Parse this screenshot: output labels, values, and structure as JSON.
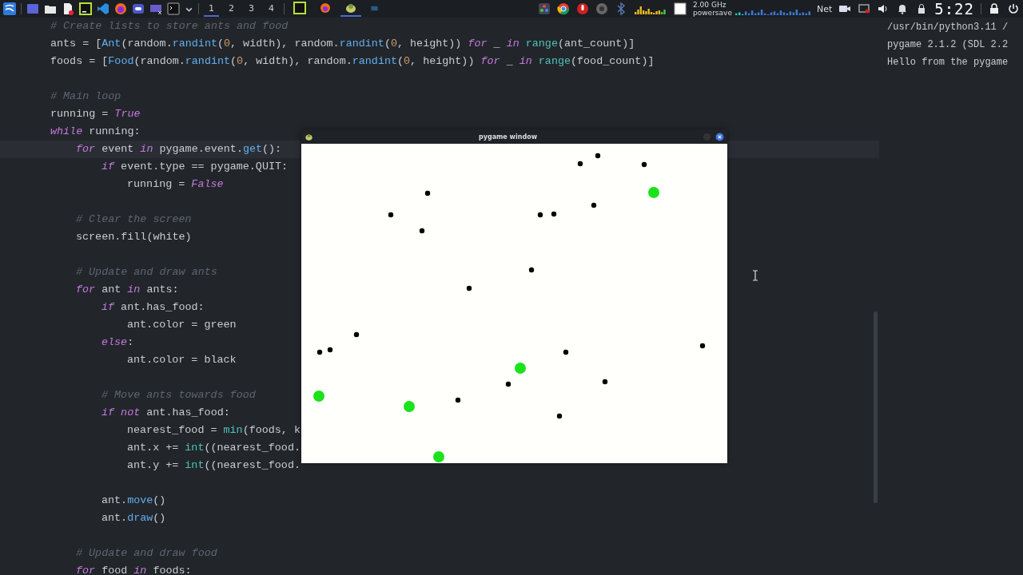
{
  "taskbar": {
    "launchers": [
      {
        "kind": "launcher"
      },
      {
        "kind": "desktop"
      },
      {
        "kind": "files"
      },
      {
        "kind": "document"
      },
      {
        "kind": "pycharm"
      },
      {
        "kind": "vscode"
      },
      {
        "kind": "firefox"
      },
      {
        "kind": "discord"
      },
      {
        "kind": "screenshot"
      },
      {
        "kind": "terminal"
      }
    ],
    "desktops": [
      {
        "label": "1",
        "selected": true
      },
      {
        "label": "2",
        "selected": false
      },
      {
        "label": "3",
        "selected": false
      },
      {
        "label": "4",
        "selected": false
      }
    ],
    "tasks": [
      {
        "kind": "pycharm",
        "selected": false
      },
      {
        "kind": "firefox",
        "selected": false
      },
      {
        "kind": "pygame",
        "selected": true
      },
      {
        "kind": "window",
        "selected": false
      }
    ],
    "cpu_frequency": "2.00 GHz",
    "cpu_governor": "powersave",
    "net_label": "Net",
    "clock": "5:22"
  },
  "editor": {
    "lines": [
      {
        "tokens": [
          {
            "t": "# Create lists to store ants and food",
            "kind": "comment"
          }
        ]
      },
      {
        "tokens": [
          {
            "t": "ants = [",
            "kind": "plain"
          },
          {
            "t": "Ant",
            "kind": "func"
          },
          {
            "t": "(random.",
            "kind": "plain"
          },
          {
            "t": "randint",
            "kind": "func"
          },
          {
            "t": "(",
            "kind": "plain"
          },
          {
            "t": "0",
            "kind": "number"
          },
          {
            "t": ", width), random.",
            "kind": "plain"
          },
          {
            "t": "randint",
            "kind": "func"
          },
          {
            "t": "(",
            "kind": "plain"
          },
          {
            "t": "0",
            "kind": "number"
          },
          {
            "t": ", height)) ",
            "kind": "plain"
          },
          {
            "t": "for",
            "kind": "keyword"
          },
          {
            "t": " _ ",
            "kind": "plain"
          },
          {
            "t": "in",
            "kind": "keyword"
          },
          {
            "t": " range",
            "kind": "builtin"
          },
          {
            "t": "(ant_count)]",
            "kind": "plain"
          }
        ]
      },
      {
        "tokens": [
          {
            "t": "foods = [",
            "kind": "plain"
          },
          {
            "t": "Food",
            "kind": "func"
          },
          {
            "t": "(random.",
            "kind": "plain"
          },
          {
            "t": "randint",
            "kind": "func"
          },
          {
            "t": "(",
            "kind": "plain"
          },
          {
            "t": "0",
            "kind": "number"
          },
          {
            "t": ", width), random.",
            "kind": "plain"
          },
          {
            "t": "randint",
            "kind": "func"
          },
          {
            "t": "(",
            "kind": "plain"
          },
          {
            "t": "0",
            "kind": "number"
          },
          {
            "t": ", height)) ",
            "kind": "plain"
          },
          {
            "t": "for",
            "kind": "keyword"
          },
          {
            "t": " _ ",
            "kind": "plain"
          },
          {
            "t": "in",
            "kind": "keyword"
          },
          {
            "t": " range",
            "kind": "builtin"
          },
          {
            "t": "(food_count)]",
            "kind": "plain"
          }
        ]
      },
      {
        "gap_before": true,
        "tokens": [
          {
            "t": "# Main loop",
            "kind": "comment"
          }
        ]
      },
      {
        "tokens": [
          {
            "t": "running = ",
            "kind": "plain"
          },
          {
            "t": "True",
            "kind": "keyword"
          }
        ]
      },
      {
        "tokens": [
          {
            "t": "while",
            "kind": "keyword"
          },
          {
            "t": " running:",
            "kind": "plain"
          }
        ],
        "children": [
          {
            "current": true,
            "tokens": [
              {
                "t": "for",
                "kind": "keyword"
              },
              {
                "t": " event ",
                "kind": "plain"
              },
              {
                "t": "in",
                "kind": "keyword"
              },
              {
                "t": " pygame.event.",
                "kind": "plain"
              },
              {
                "t": "get",
                "kind": "func"
              },
              {
                "t": "():",
                "kind": "plain"
              }
            ],
            "children": [
              {
                "tokens": [
                  {
                    "t": "if",
                    "kind": "keyword"
                  },
                  {
                    "t": " event.type == pygame.QUIT:",
                    "kind": "plain"
                  }
                ],
                "children": [
                  {
                    "tokens": [
                      {
                        "t": "running = ",
                        "kind": "plain"
                      },
                      {
                        "t": "False",
                        "kind": "keyword"
                      }
                    ]
                  }
                ]
              }
            ]
          },
          {
            "gap_before": true,
            "tokens": [
              {
                "t": "# Clear the screen",
                "kind": "comment"
              }
            ]
          },
          {
            "tokens": [
              {
                "t": "screen.fill(white)",
                "kind": "plain"
              }
            ]
          },
          {
            "gap_before": true,
            "tokens": [
              {
                "t": "# Update and draw ants",
                "kind": "comment"
              }
            ]
          },
          {
            "tokens": [
              {
                "t": "for",
                "kind": "keyword"
              },
              {
                "t": " ant ",
                "kind": "plain"
              },
              {
                "t": "in",
                "kind": "keyword"
              },
              {
                "t": " ants:",
                "kind": "plain"
              }
            ],
            "children": [
              {
                "tokens": [
                  {
                    "t": "if",
                    "kind": "keyword"
                  },
                  {
                    "t": " ant.has_food:",
                    "kind": "plain"
                  }
                ],
                "children": [
                  {
                    "tokens": [
                      {
                        "t": "ant.color = green",
                        "kind": "plain"
                      }
                    ]
                  }
                ]
              },
              {
                "tokens": [
                  {
                    "t": "else",
                    "kind": "keyword"
                  },
                  {
                    "t": ":",
                    "kind": "plain"
                  }
                ],
                "children": [
                  {
                    "tokens": [
                      {
                        "t": "ant.color = black",
                        "kind": "plain"
                      }
                    ]
                  }
                ]
              },
              {
                "gap_before": true,
                "tokens": [
                  {
                    "t": "# Move ants towards food",
                    "kind": "comment"
                  }
                ]
              },
              {
                "tokens": [
                  {
                    "t": "if",
                    "kind": "keyword"
                  },
                  {
                    "t": " not",
                    "kind": "keyword"
                  },
                  {
                    "t": " ant.has_food:",
                    "kind": "plain"
                  }
                ],
                "children": [
                  {
                    "tokens": [
                      {
                        "t": "nearest_food = ",
                        "kind": "plain"
                      },
                      {
                        "t": "min",
                        "kind": "builtin"
                      },
                      {
                        "t": "(foods, k",
                        "kind": "plain"
                      }
                    ]
                  },
                  {
                    "tokens": [
                      {
                        "t": "ant.x += ",
                        "kind": "plain"
                      },
                      {
                        "t": "int",
                        "kind": "builtin"
                      },
                      {
                        "t": "((nearest_food.",
                        "kind": "plain"
                      }
                    ]
                  },
                  {
                    "tokens": [
                      {
                        "t": "ant.y += ",
                        "kind": "plain"
                      },
                      {
                        "t": "int",
                        "kind": "builtin"
                      },
                      {
                        "t": "((nearest_food.",
                        "kind": "plain"
                      }
                    ]
                  }
                ]
              },
              {
                "gap_before": true,
                "tokens": [
                  {
                    "t": "ant.",
                    "kind": "plain"
                  },
                  {
                    "t": "move",
                    "kind": "func"
                  },
                  {
                    "t": "()",
                    "kind": "plain"
                  }
                ]
              },
              {
                "tokens": [
                  {
                    "t": "ant.",
                    "kind": "plain"
                  },
                  {
                    "t": "draw",
                    "kind": "func"
                  },
                  {
                    "t": "()",
                    "kind": "plain"
                  }
                ]
              }
            ]
          },
          {
            "gap_before": true,
            "tokens": [
              {
                "t": "# Update and draw food",
                "kind": "comment"
              }
            ]
          },
          {
            "tokens": [
              {
                "t": "for",
                "kind": "keyword"
              },
              {
                "t": " food ",
                "kind": "plain"
              },
              {
                "t": "in",
                "kind": "keyword"
              },
              {
                "t": " foods:",
                "kind": "plain"
              }
            ]
          }
        ]
      }
    ]
  },
  "terminal": {
    "lines": [
      "/usr/bin/python3.11 /",
      "pygame 2.1.2 (SDL 2.2",
      "Hello from the pygame"
    ]
  },
  "pygame_window": {
    "title": "pygame window"
  }
}
